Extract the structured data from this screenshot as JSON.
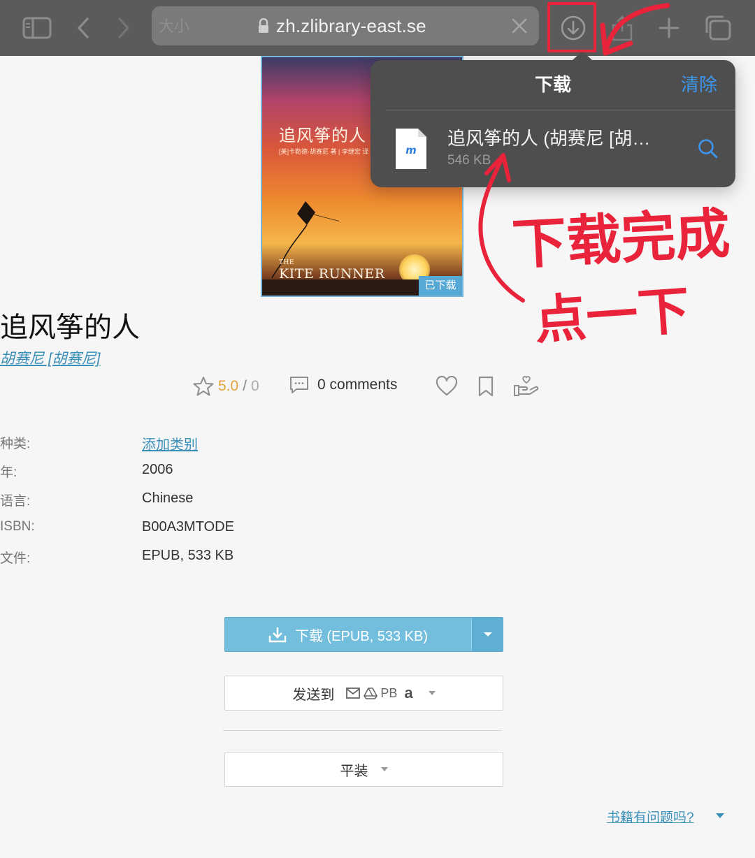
{
  "browser": {
    "text_size_label": "大小",
    "url": "zh.zlibrary-east.se"
  },
  "book": {
    "cover": {
      "title": "追风筝的人",
      "subtitle": "[美]卡勒德·胡赛尼 著 | 李继宏 译",
      "english_title": "KITE RUNNER",
      "english_prefix": "THE",
      "badge": "已下载"
    },
    "title": "追风筝的人",
    "author": "胡赛尼 [胡赛尼]",
    "rating": {
      "score": "5.0",
      "separator": "/",
      "count": "0"
    },
    "comments": "0 comments",
    "meta": [
      {
        "key": "种类:",
        "value": "添加类别",
        "link": true
      },
      {
        "key": "年:",
        "value": "2006",
        "link": false
      },
      {
        "key": "语言:",
        "value": "Chinese",
        "link": false
      },
      {
        "key": "ISBN:",
        "value": "B00A3MTODE",
        "link": false
      },
      {
        "key": "文件:",
        "value": "EPUB, 533 KB",
        "link": false
      }
    ]
  },
  "actions": {
    "download_label": "下载 (EPUB, 533 KB)",
    "send_to_label": "发送到",
    "send_pb": "PB",
    "send_amazon": "a",
    "binding_label": "平装",
    "problem_link": "书籍有问题吗?"
  },
  "downloads_popover": {
    "title": "下载",
    "clear": "清除",
    "file_name": "追风筝的人 (胡赛尼 [胡…",
    "file_size": "546 KB"
  },
  "annotations": {
    "note_line1": "下载完成",
    "note_line2": "点一下",
    "color": "#e8233a"
  }
}
